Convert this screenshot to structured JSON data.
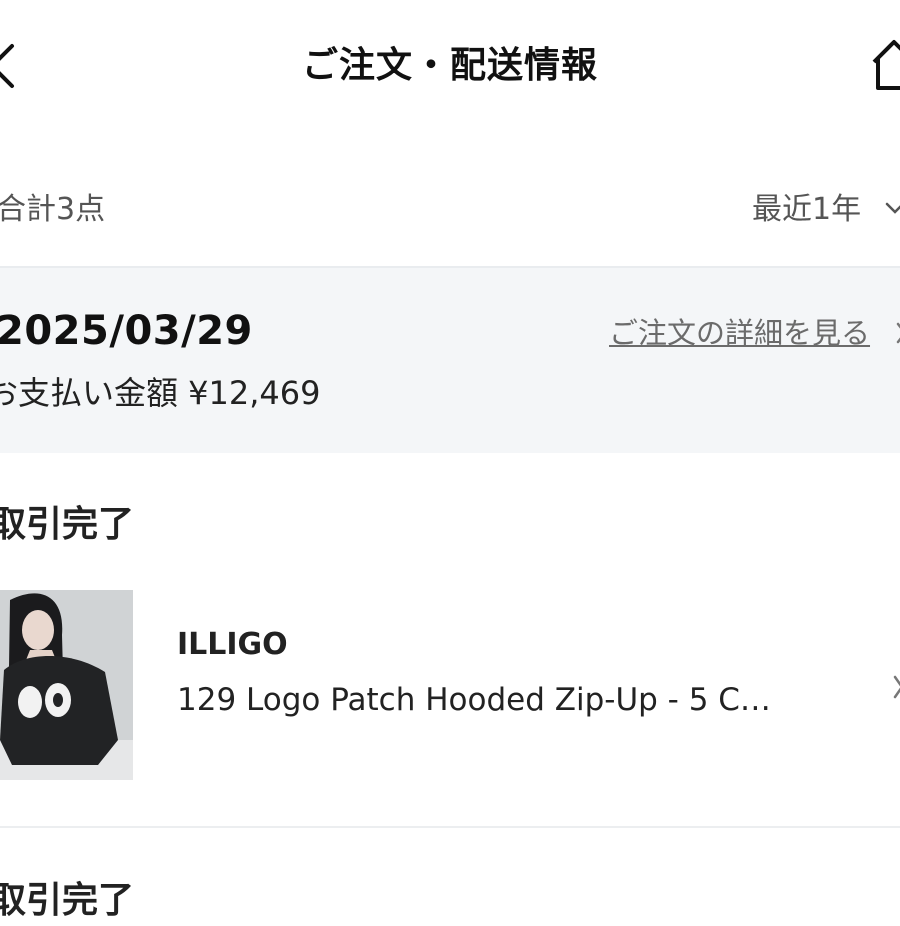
{
  "header": {
    "title": "ご注文・配送情報",
    "back_icon": "chevron-left-icon",
    "home_icon": "home-icon"
  },
  "filter": {
    "count_label": "合計3点",
    "period_label": "最近1年"
  },
  "order": {
    "date": "2025/03/29",
    "detail_link": "ご注文の詳細を見る",
    "payment": "お支払い金額 ¥12,469"
  },
  "items": [
    {
      "status": "取引完了",
      "brand": "ILLIGO",
      "name": "129 Logo Patch Hooded Zip-Up - 5 C…"
    },
    {
      "status": "取引完了"
    }
  ],
  "colors": {
    "panel_bg": "#f4f6f8",
    "muted_text": "#6b6b6b"
  }
}
